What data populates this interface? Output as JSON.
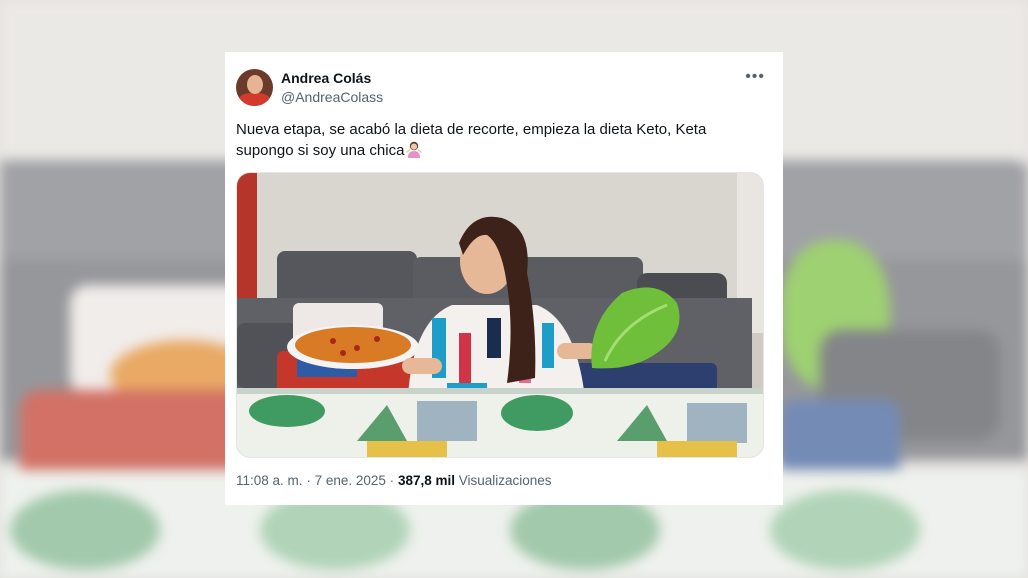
{
  "tweet": {
    "author_name": "Andrea Colás",
    "author_handle": "@AndreaColass",
    "more_icon": "more-options-icon",
    "text_line1": "Nueva etapa, se acabó la dieta de recorte, empieza la dieta Keto, Keta",
    "text_line2": "supongo si soy una chica",
    "emoji_icon": "woman-shrugging-emoji-icon",
    "time": "11:08 a. m.",
    "separator": "·",
    "date": "7 ene. 2025",
    "views_count": "387,8 mil",
    "views_label": "Visualizaciones"
  },
  "colors": {
    "text_primary": "#0f1419",
    "text_secondary": "#536471",
    "card_bg": "#ffffff"
  }
}
